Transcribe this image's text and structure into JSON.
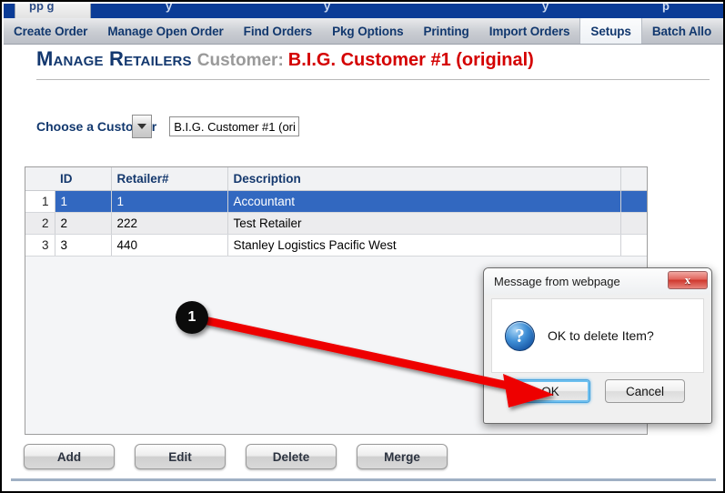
{
  "window": {
    "top_tabs_ghost": [
      "pp g",
      "y",
      "y",
      "y",
      "p"
    ]
  },
  "nav": {
    "items": [
      {
        "label": "Create Order",
        "active": false
      },
      {
        "label": "Manage Open Order",
        "active": false
      },
      {
        "label": "Find Orders",
        "active": false
      },
      {
        "label": "Pkg Options",
        "active": false
      },
      {
        "label": "Printing",
        "active": false
      },
      {
        "label": "Import Orders",
        "active": false
      },
      {
        "label": "Setups",
        "active": true
      },
      {
        "label": "Batch Allo",
        "active": false
      }
    ]
  },
  "page": {
    "title": "Manage Retailers",
    "customer_label": "Customer:",
    "customer_name": "B.I.G. Customer #1 (original)"
  },
  "chooser": {
    "label": "Choose a Customer",
    "selected": "B.I.G. Customer #1 (ori",
    "caret_icon": "chevron-down-icon"
  },
  "grid": {
    "columns": [
      "",
      "ID",
      "Retailer#",
      "Description",
      ""
    ],
    "rows": [
      {
        "num": "1",
        "id": "1",
        "retailer": "1",
        "description": "Accountant",
        "selected": true
      },
      {
        "num": "2",
        "id": "2",
        "retailer": "222",
        "description": "Test Retailer",
        "selected": false
      },
      {
        "num": "3",
        "id": "3",
        "retailer": "440",
        "description": "Stanley Logistics Pacific West",
        "selected": false
      }
    ]
  },
  "actions": {
    "add": "Add",
    "edit": "Edit",
    "delete": "Delete",
    "merge": "Merge"
  },
  "dialog": {
    "title": "Message from webpage",
    "close_icon": "close-icon",
    "icon": "question-icon",
    "icon_glyph": "?",
    "message": "OK to delete Item?",
    "ok": "OK",
    "cancel": "Cancel"
  },
  "annotation": {
    "badge_number": "1",
    "arrow_color": "#ee0000",
    "badge_color": "#0b0b0b"
  },
  "colors": {
    "nav_text": "#12386e",
    "title_navy": "#13386f",
    "customer_red": "#d40000",
    "row_selected": "#3268c0"
  }
}
